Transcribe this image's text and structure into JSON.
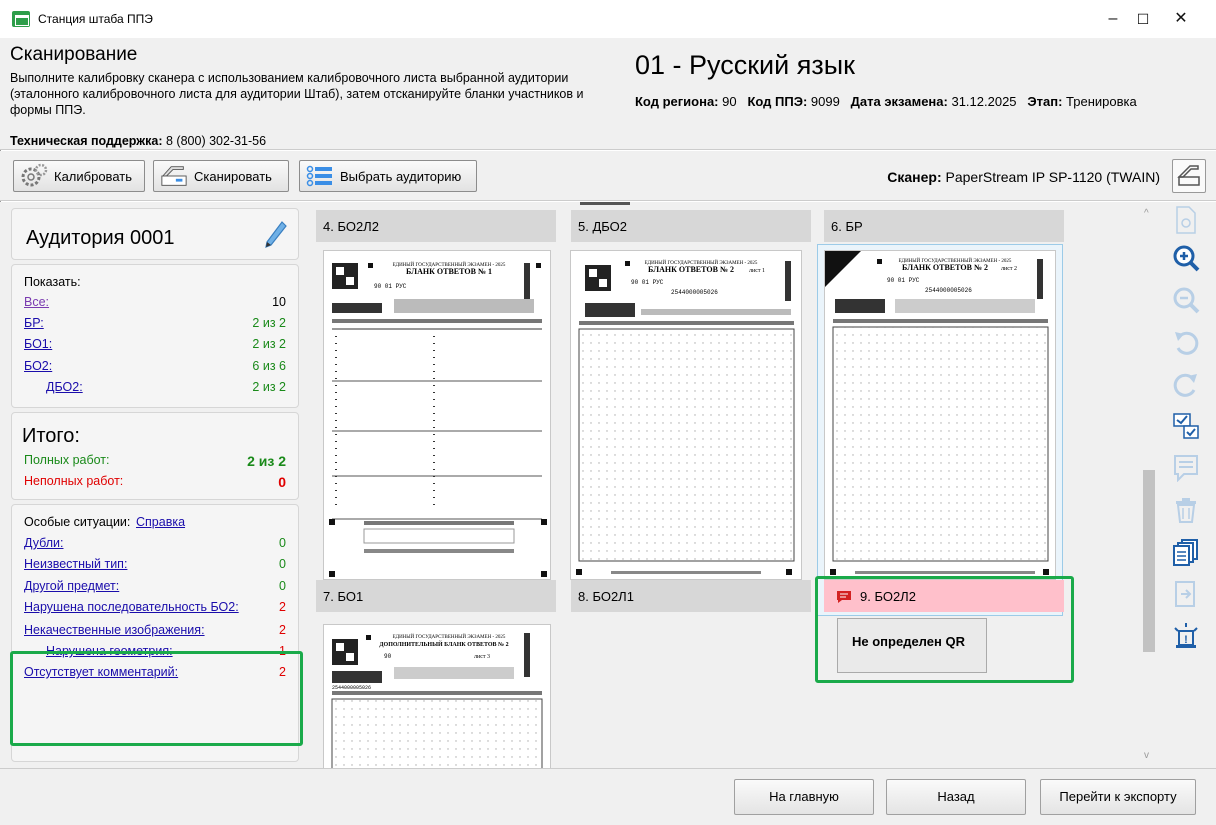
{
  "window": {
    "title": "Станция штаба ППЭ",
    "minimize": "–",
    "maximize": "☐",
    "close": "✕"
  },
  "header": {
    "title": "Сканирование",
    "description": "Выполните калибровку сканера с использованием калибровочного листа выбранной аудитории (эталонного калибровочного листа для аудитории Штаб), затем отсканируйте бланки участников и формы ППЭ.",
    "support_label": "Техническая поддержка:",
    "support_value": "8 (800) 302-31-56",
    "subject": "01 - Русский язык",
    "region_label": "Код региона:",
    "region_value": "90",
    "ppe_label": "Код ППЭ:",
    "ppe_value": "9099",
    "date_label": "Дата экзамена:",
    "date_value": "31.12.2025",
    "stage_label": "Этап:",
    "stage_value": "Тренировка"
  },
  "toolbar": {
    "calibrate": "Калибровать",
    "scan": "Сканировать",
    "select_room": "Выбрать аудиторию",
    "scanner_label": "Сканер:",
    "scanner_value": "PaperStream IP SP-1120 (TWAIN)"
  },
  "left": {
    "room_name": "Аудитория 0001",
    "show_label": "Показать:",
    "filters": [
      {
        "label": "Все:",
        "value": "10"
      },
      {
        "label": "БР:",
        "value": "2 из 2"
      },
      {
        "label": "БО1:",
        "value": "2 из 2"
      },
      {
        "label": "БО2:",
        "value": "6 из 6"
      },
      {
        "label": "ДБО2:",
        "value": "2 из 2"
      }
    ],
    "total_label": "Итого:",
    "full_label": "Полных работ:",
    "full_value": "2 из 2",
    "incomplete_label": "Неполных работ:",
    "incomplete_value": "0",
    "special_label": "Особые ситуации:",
    "help_link": "Справка",
    "special": [
      {
        "label": "Дубли:",
        "value": "0"
      },
      {
        "label": "Неизвестный тип:",
        "value": "0"
      },
      {
        "label": "Другой предмет:",
        "value": "0"
      },
      {
        "label": "Нарушена последовательность БО2:",
        "value": "2"
      },
      {
        "label": "Некачественные изображения:",
        "value": "2"
      },
      {
        "label": "Нарушена геометрия:",
        "value": "1"
      },
      {
        "label": "Отсутствует комментарий:",
        "value": "2"
      }
    ]
  },
  "docs": {
    "top": [
      "4. БО2Л2",
      "5. ДБО2",
      "6. БР"
    ],
    "mid": [
      "7. БО1",
      "8. БО2Л1",
      "9. БО2Л2"
    ],
    "error_note": "Не определен QR",
    "pages": [
      {
        "title": "ЕДИНЫЙ ГОСУДАРСТВЕННЫЙ ЭКЗАМЕН - 2025",
        "subtitle": "БЛАНК ОТВЕТОВ № 1",
        "code": "90  01  РУС"
      },
      {
        "title": "ЕДИНЫЙ ГОСУДАРСТВЕННЫЙ ЭКЗАМЕН - 2025",
        "subtitle": "БЛАНК ОТВЕТОВ № 2",
        "sheet": "лист 1",
        "code": "90  01  РУС",
        "number": "2544000005026"
      },
      {
        "title": "ЕДИНЫЙ ГОСУДАРСТВЕННЫЙ ЭКЗАМЕН - 2025",
        "subtitle": "БЛАНК ОТВЕТОВ № 2",
        "sheet": "лист 2",
        "code": "90  01  РУС",
        "number": "2544000005026"
      },
      {
        "title": "ЕДИНЫЙ ГОСУДАРСТВЕННЫЙ ЭКЗАМЕН - 2025",
        "subtitle": "ДОПОЛНИТЕЛЬНЫЙ БЛАНК ОТВЕТОВ № 2",
        "code": "90",
        "sheet": "лист 3",
        "number": "2544000005026"
      }
    ]
  },
  "footer": {
    "home": "На главную",
    "back": "Назад",
    "export": "Перейти к экспорту"
  },
  "colors": {
    "highlight": "#1aaa4a",
    "error_bg": "#ffc0cb",
    "link": "#1a0dab",
    "green": "#1a8a1a",
    "red": "#e00000"
  }
}
